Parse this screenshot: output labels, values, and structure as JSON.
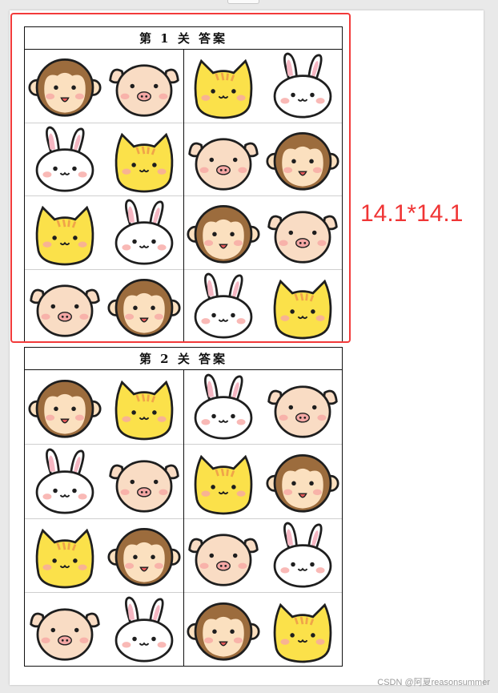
{
  "sheets": [
    {
      "title": "第 1 关 答案",
      "rows": [
        [
          "monkey-face-icon",
          "pig-face-icon",
          "cat-face-icon",
          "rabbit-face-icon"
        ],
        [
          "rabbit-face-icon",
          "cat-face-icon",
          "pig-face-icon",
          "monkey-face-icon"
        ],
        [
          "cat-face-icon",
          "rabbit-face-icon",
          "monkey-face-icon",
          "pig-face-icon"
        ],
        [
          "pig-face-icon",
          "monkey-face-icon",
          "rabbit-face-icon",
          "cat-face-icon"
        ]
      ]
    },
    {
      "title": "第 2 关 答案",
      "rows": [
        [
          "monkey-face-icon",
          "cat-face-icon",
          "rabbit-face-icon",
          "pig-face-icon"
        ],
        [
          "rabbit-face-icon",
          "pig-face-icon",
          "cat-face-icon",
          "monkey-face-icon"
        ],
        [
          "cat-face-icon",
          "monkey-face-icon",
          "pig-face-icon",
          "rabbit-face-icon"
        ],
        [
          "pig-face-icon",
          "rabbit-face-icon",
          "monkey-face-icon",
          "cat-face-icon"
        ]
      ]
    }
  ],
  "annotation": {
    "dimension": "14.1*14.1",
    "color": "#f03535"
  },
  "watermark": "CSDN @阿夏reasonsummer",
  "colors": {
    "cat": "#fbe14a",
    "cat_stripes": "#f0a449",
    "monkey_fur": "#9c6c3d",
    "monkey_face": "#fbe0bf",
    "pig": "#f9dcc4",
    "rabbit": "#ffffff",
    "rabbit_ear": "#f6b7c3",
    "outline": "#1e1e1e",
    "blush": "#f7a7a4"
  }
}
